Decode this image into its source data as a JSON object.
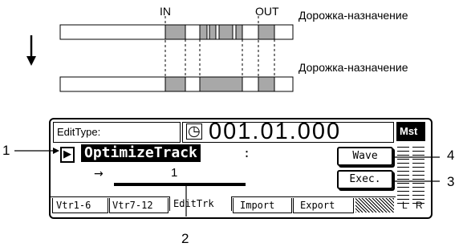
{
  "diagram": {
    "marker_in": "IN",
    "marker_out": "OUT",
    "source_track_label": "Дорожка-назначение",
    "dest_track_label": "Дорожка-назначение",
    "arrow_glyph": "↓"
  },
  "screen": {
    "edit_type_label": "EditType:",
    "clock_icon_glyph": "◷",
    "time_value": "001.01.000",
    "master_label": "Mst",
    "play_icon_glyph": "▶",
    "function_name": "OptimizeTrack",
    "colon": ":",
    "wave_button_label": "Wave",
    "exec_button_label": "Exec.",
    "target_arrow": "→",
    "target_value": "1",
    "tabs": [
      "Vtr1-6",
      "Vtr7-12",
      "EditTrk",
      "Import",
      "Export"
    ],
    "active_tab": "EditTrk",
    "meter_labels": [
      "L",
      "R"
    ]
  },
  "callouts": [
    "1",
    "2",
    "3",
    "4"
  ],
  "colors": {
    "region_fill": "#a8a8a8",
    "inverse_bg": "#000000",
    "inverse_fg": "#ffffff"
  }
}
